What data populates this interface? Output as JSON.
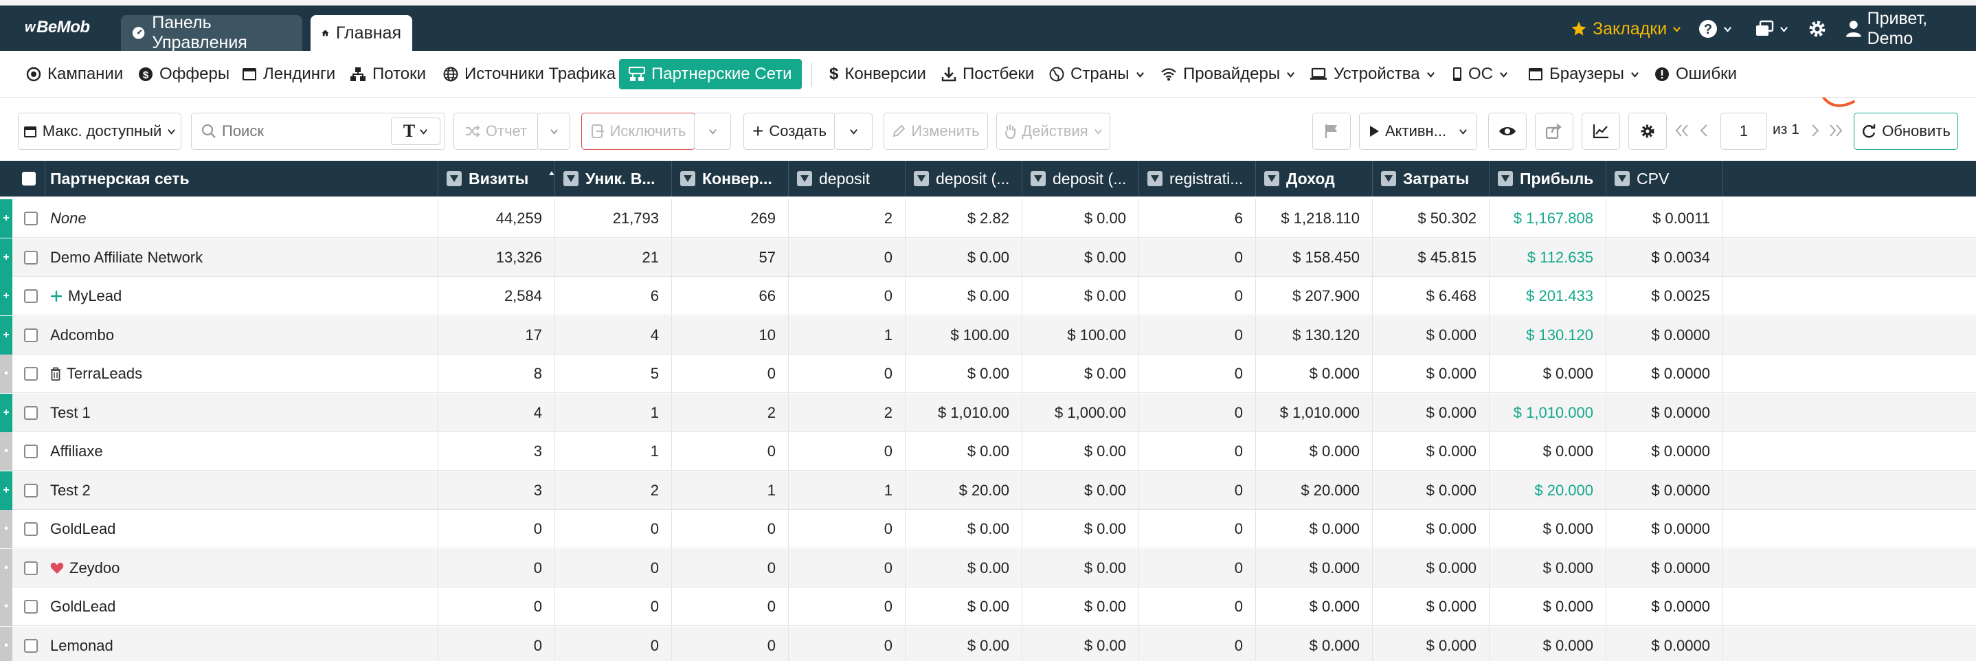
{
  "app": {
    "logo": "BeMob"
  },
  "tabs": [
    {
      "label": "Панель Управления"
    },
    {
      "label": "Главная"
    }
  ],
  "header": {
    "bookmarks": "Закладки",
    "greeting": "Привет, Demo"
  },
  "nav": [
    {
      "label": "Кампании",
      "icon": "target-icon"
    },
    {
      "label": "Офферы",
      "icon": "dollar-circle-icon"
    },
    {
      "label": "Лендинги",
      "icon": "browser-window-icon"
    },
    {
      "label": "Потоки",
      "icon": "flow-icon"
    },
    {
      "label": "Источники Трафика",
      "icon": "globe-icon"
    },
    {
      "label": "Партнерские Сети",
      "icon": "network-icon",
      "active": true
    },
    {
      "label": "Конверсии",
      "icon": "dollar-icon"
    },
    {
      "label": "Постбеки",
      "icon": "download-icon"
    },
    {
      "label": "Страны",
      "icon": "globe-icon"
    },
    {
      "label": "Провайдеры",
      "icon": "wifi-icon"
    },
    {
      "label": "Устройства",
      "icon": "laptop-icon"
    },
    {
      "label": "ОС",
      "icon": "phone-icon"
    },
    {
      "label": "Браузеры",
      "icon": "browser-window-icon"
    },
    {
      "label": "Ошибки",
      "icon": "alert-icon"
    }
  ],
  "toolbar": {
    "date_range": "Макс. доступный",
    "search_placeholder": "Поиск",
    "report": "Отчет",
    "exclude": "Исключить",
    "create": "Создать",
    "edit": "Изменить",
    "actions": "Действия",
    "status_filter": "Активн...",
    "page": "1",
    "page_of": "из 1",
    "refresh": "Обновить"
  },
  "table": {
    "columns": [
      "Партнерская сеть",
      "Визиты",
      "Уник. В...",
      "Конвер...",
      "deposit",
      "deposit (...",
      "deposit (...",
      "registrati...",
      "Доход",
      "Затраты",
      "Прибыль",
      "CPV"
    ],
    "rows": [
      {
        "name": "None",
        "italic": true,
        "status": "on",
        "cells": [
          "44,259",
          "21,793",
          "269",
          "2",
          "$ 2.82",
          "$ 0.00",
          "6",
          "$ 1,218.110",
          "$ 50.302",
          "$ 1,167.808",
          "$ 0.0011"
        ],
        "profit_green": true
      },
      {
        "name": "Demo Affiliate Network",
        "status": "on",
        "cells": [
          "13,326",
          "21",
          "57",
          "0",
          "$ 0.00",
          "$ 0.00",
          "0",
          "$ 158.450",
          "$ 45.815",
          "$ 112.635",
          "$ 0.0034"
        ],
        "profit_green": true
      },
      {
        "name": "MyLead",
        "status": "on",
        "prefix": "plus-icon",
        "cells": [
          "2,584",
          "6",
          "66",
          "0",
          "$ 0.00",
          "$ 0.00",
          "0",
          "$ 207.900",
          "$ 6.468",
          "$ 201.433",
          "$ 0.0025"
        ],
        "profit_green": true
      },
      {
        "name": "Adcombo",
        "status": "on",
        "cells": [
          "17",
          "4",
          "10",
          "1",
          "$ 100.00",
          "$ 100.00",
          "0",
          "$ 130.120",
          "$ 0.000",
          "$ 130.120",
          "$ 0.0000"
        ],
        "profit_green": true
      },
      {
        "name": "TerraLeads",
        "status": "off",
        "prefix": "trash-icon",
        "cells": [
          "8",
          "5",
          "0",
          "0",
          "$ 0.00",
          "$ 0.00",
          "0",
          "$ 0.000",
          "$ 0.000",
          "$ 0.000",
          "$ 0.0000"
        ],
        "profit_green": false
      },
      {
        "name": "Test 1",
        "status": "on",
        "cells": [
          "4",
          "1",
          "2",
          "2",
          "$ 1,010.00",
          "$ 1,000.00",
          "0",
          "$ 1,010.000",
          "$ 0.000",
          "$ 1,010.000",
          "$ 0.0000"
        ],
        "profit_green": true
      },
      {
        "name": "Affiliaxe",
        "status": "off",
        "cells": [
          "3",
          "1",
          "0",
          "0",
          "$ 0.00",
          "$ 0.00",
          "0",
          "$ 0.000",
          "$ 0.000",
          "$ 0.000",
          "$ 0.0000"
        ],
        "profit_green": false
      },
      {
        "name": "Test 2",
        "status": "on",
        "cells": [
          "3",
          "2",
          "1",
          "1",
          "$ 20.00",
          "$ 0.00",
          "0",
          "$ 20.000",
          "$ 0.000",
          "$ 20.000",
          "$ 0.0000"
        ],
        "profit_green": true
      },
      {
        "name": "GoldLead",
        "status": "off",
        "cells": [
          "0",
          "0",
          "0",
          "0",
          "$ 0.00",
          "$ 0.00",
          "0",
          "$ 0.000",
          "$ 0.000",
          "$ 0.000",
          "$ 0.0000"
        ],
        "profit_green": false
      },
      {
        "name": "Zeydoo",
        "status": "off",
        "prefix": "heart-icon",
        "cells": [
          "0",
          "0",
          "0",
          "0",
          "$ 0.00",
          "$ 0.00",
          "0",
          "$ 0.000",
          "$ 0.000",
          "$ 0.000",
          "$ 0.0000"
        ],
        "profit_green": false
      },
      {
        "name": "GoldLead",
        "status": "off",
        "cells": [
          "0",
          "0",
          "0",
          "0",
          "$ 0.00",
          "$ 0.00",
          "0",
          "$ 0.000",
          "$ 0.000",
          "$ 0.000",
          "$ 0.0000"
        ],
        "profit_green": false
      },
      {
        "name": "Lemonad",
        "status": "off",
        "cells": [
          "0",
          "0",
          "0",
          "0",
          "$ 0.00",
          "$ 0.00",
          "0",
          "$ 0.000",
          "$ 0.000",
          "$ 0.000",
          "$ 0.0000"
        ],
        "profit_green": false
      }
    ]
  },
  "colors": {
    "accent": "#14a88c",
    "header_bg": "#1f3644",
    "bookmark": "#f5b800",
    "annotation": "#f05a28"
  }
}
